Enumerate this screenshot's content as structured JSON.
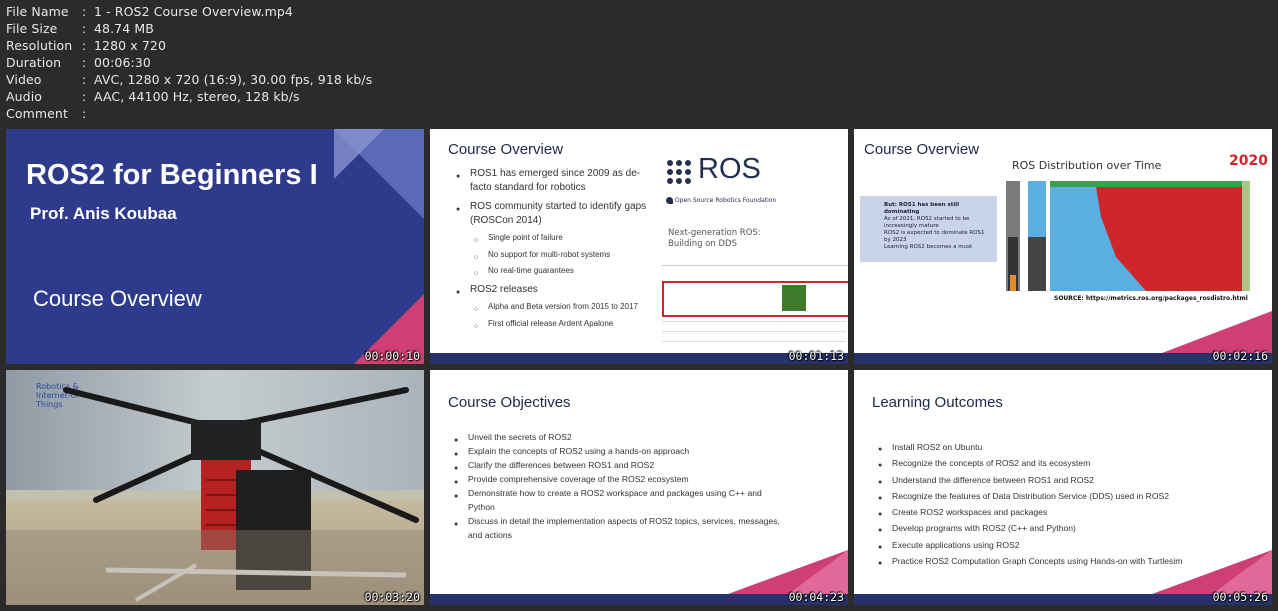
{
  "info": [
    {
      "key": "File Name",
      "value": "1 - ROS2 Course Overview.mp4"
    },
    {
      "key": "File Size",
      "value": "48.74 MB"
    },
    {
      "key": "Resolution",
      "value": "1280 x 720"
    },
    {
      "key": "Duration",
      "value": "00:06:30"
    },
    {
      "key": "Video",
      "value": "AVC, 1280 x 720 (16:9), 30.00 fps, 918 kb/s"
    },
    {
      "key": "Audio",
      "value": "AAC, 44100 Hz, stereo, 128 kb/s"
    },
    {
      "key": "Comment",
      "value": ""
    }
  ],
  "sep": ":",
  "colors": {
    "navy": "#2e3a8c",
    "pink": "#cf3f73",
    "red": "#d0252b",
    "blue": "#5aaee0",
    "green": "#3aa04a"
  },
  "thumb1": {
    "title": "ROS2 for Beginners I",
    "author": "Prof. Anis Koubaa",
    "subtitle": "Course Overview",
    "timestamp": "00:00:10"
  },
  "thumb2": {
    "title": "Course Overview",
    "bullets": [
      {
        "text": "ROS1 has emerged since 2009 as de-facto standard for robotics",
        "level": 0
      },
      {
        "text": "ROS community started to identify gaps (ROSCon 2014)",
        "level": 0
      },
      {
        "text": "Single point of failure",
        "level": 1
      },
      {
        "text": "No support for multi-robot systems",
        "level": 1
      },
      {
        "text": "No real-time guarantees",
        "level": 1
      },
      {
        "text": "ROS2 releases",
        "level": 0
      },
      {
        "text": "Alpha and Beta version from 2015 to 2017",
        "level": 1
      },
      {
        "text": "First official release Ardent Apalone",
        "level": 1
      }
    ],
    "logo": "ROS",
    "logo_sub": "Open Source Robotics Foundation",
    "next_gen": "Next-generation ROS: Building on DDS",
    "timestamp": "00:01:13"
  },
  "thumb3": {
    "title": "Course Overview",
    "chart_title": "ROS Distribution over Time",
    "year": "2020",
    "box": [
      "But: ROS1 has been still dominating",
      "As of 2021, ROS2 started to be increasingly mature",
      "ROS2 is expected to dominate ROS1 by 2023",
      "Learning ROS2 becomes a must"
    ],
    "source": "SOURCE: https://metrics.ros.org/packages_rosdistro.html",
    "timestamp": "00:02:16"
  },
  "thumb4": {
    "logo_text": "Robotics & Internet-of-Things",
    "timestamp": "00:03:20"
  },
  "thumb5": {
    "title": "Course Objectives",
    "bullets": [
      "Unveil the secrets of ROS2",
      "Explain the concepts of ROS2 using a hands-on approach",
      "Clarify the differences between ROS1 and ROS2",
      "Provide comprehensive coverage of the ROS2 ecosystem",
      "Demonstrate how to create a ROS2 workspace and packages using C++ and Python",
      "Discuss in detail the implementation aspects of ROS2 topics, services, messages, and actions"
    ],
    "timestamp": "00:04:23"
  },
  "thumb6": {
    "title": "Learning Outcomes",
    "bullets": [
      "Install ROS2 on Ubuntu",
      "Recognize the concepts of ROS2 and its ecosystem",
      "Understand the difference between ROS1 and ROS2",
      "Recognize the features of Data Distribution Service (DDS) used in ROS2",
      "Create ROS2 workspaces and packages",
      "Develop programs with ROS2 (C++ and Python)",
      "Execute applications using ROS2",
      "Practice ROS2 Computation Graph Concepts using Hands-on with Turtlesim"
    ],
    "timestamp": "00:05:26"
  }
}
